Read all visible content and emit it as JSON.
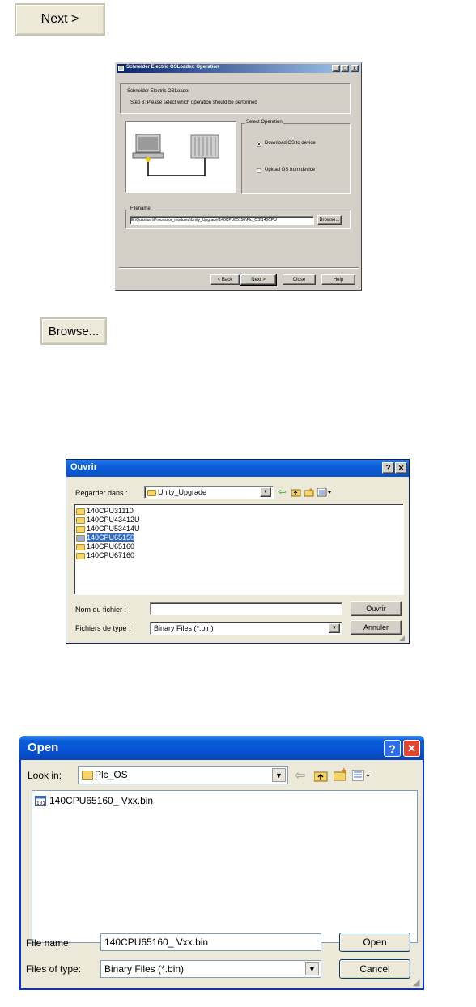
{
  "next_button": {
    "label": "Next >"
  },
  "browse_button": {
    "label": "Browse..."
  },
  "osloader": {
    "title": "Schneider Electric OSLoader: Operation",
    "header_line1": "Schneider Electric OSLoader",
    "header_line2": "Step 3: Please select which operation should be performed",
    "group_title": "Select Operation",
    "radio_download": "Download OS to device",
    "radio_upload": "Upload OS from device",
    "filename_group": "Filename",
    "filename_value": "E:\\Quantum\\Processor_modules\\Unity_Upgrade\\140CPU65150\\Plc_OS\\140CPU",
    "browse": "Browse...",
    "back": "< Back",
    "next": "Next >",
    "close": "Close",
    "help": "Help"
  },
  "ouvrir": {
    "title": "Ouvrir",
    "help_glyph": "?",
    "close_glyph": "✕",
    "look_in_label": "Regarder dans :",
    "look_in_value": "Unity_Upgrade",
    "items": [
      "140CPU31110",
      "140CPU43412U",
      "140CPU53414U",
      "140CPU65150",
      "140CPU65160",
      "140CPU67160"
    ],
    "selected_index": 3,
    "filename_label": "Nom du fichier :",
    "filename_value": "",
    "type_label": "Fichiers de type :",
    "type_value": "Binary Files (*.bin)",
    "open_btn": "Ouvrir",
    "cancel_btn": "Annuler"
  },
  "open": {
    "title": "Open",
    "help_glyph": "?",
    "close_glyph": "✕",
    "look_in_label": "Look in:",
    "look_in_value": "Plc_OS",
    "file_item": "140CPU65160_ Vxx.bin",
    "filename_label": "File name:",
    "filename_value": "140CPU65160_ Vxx.bin",
    "type_label": "Files of type:",
    "type_value": "Binary Files (*.bin)",
    "open_btn": "Open",
    "cancel_btn": "Cancel"
  },
  "colors": {
    "xp_title": "#0a5ed8",
    "w98_title": "#0a246a",
    "selection": "#316ac5"
  }
}
